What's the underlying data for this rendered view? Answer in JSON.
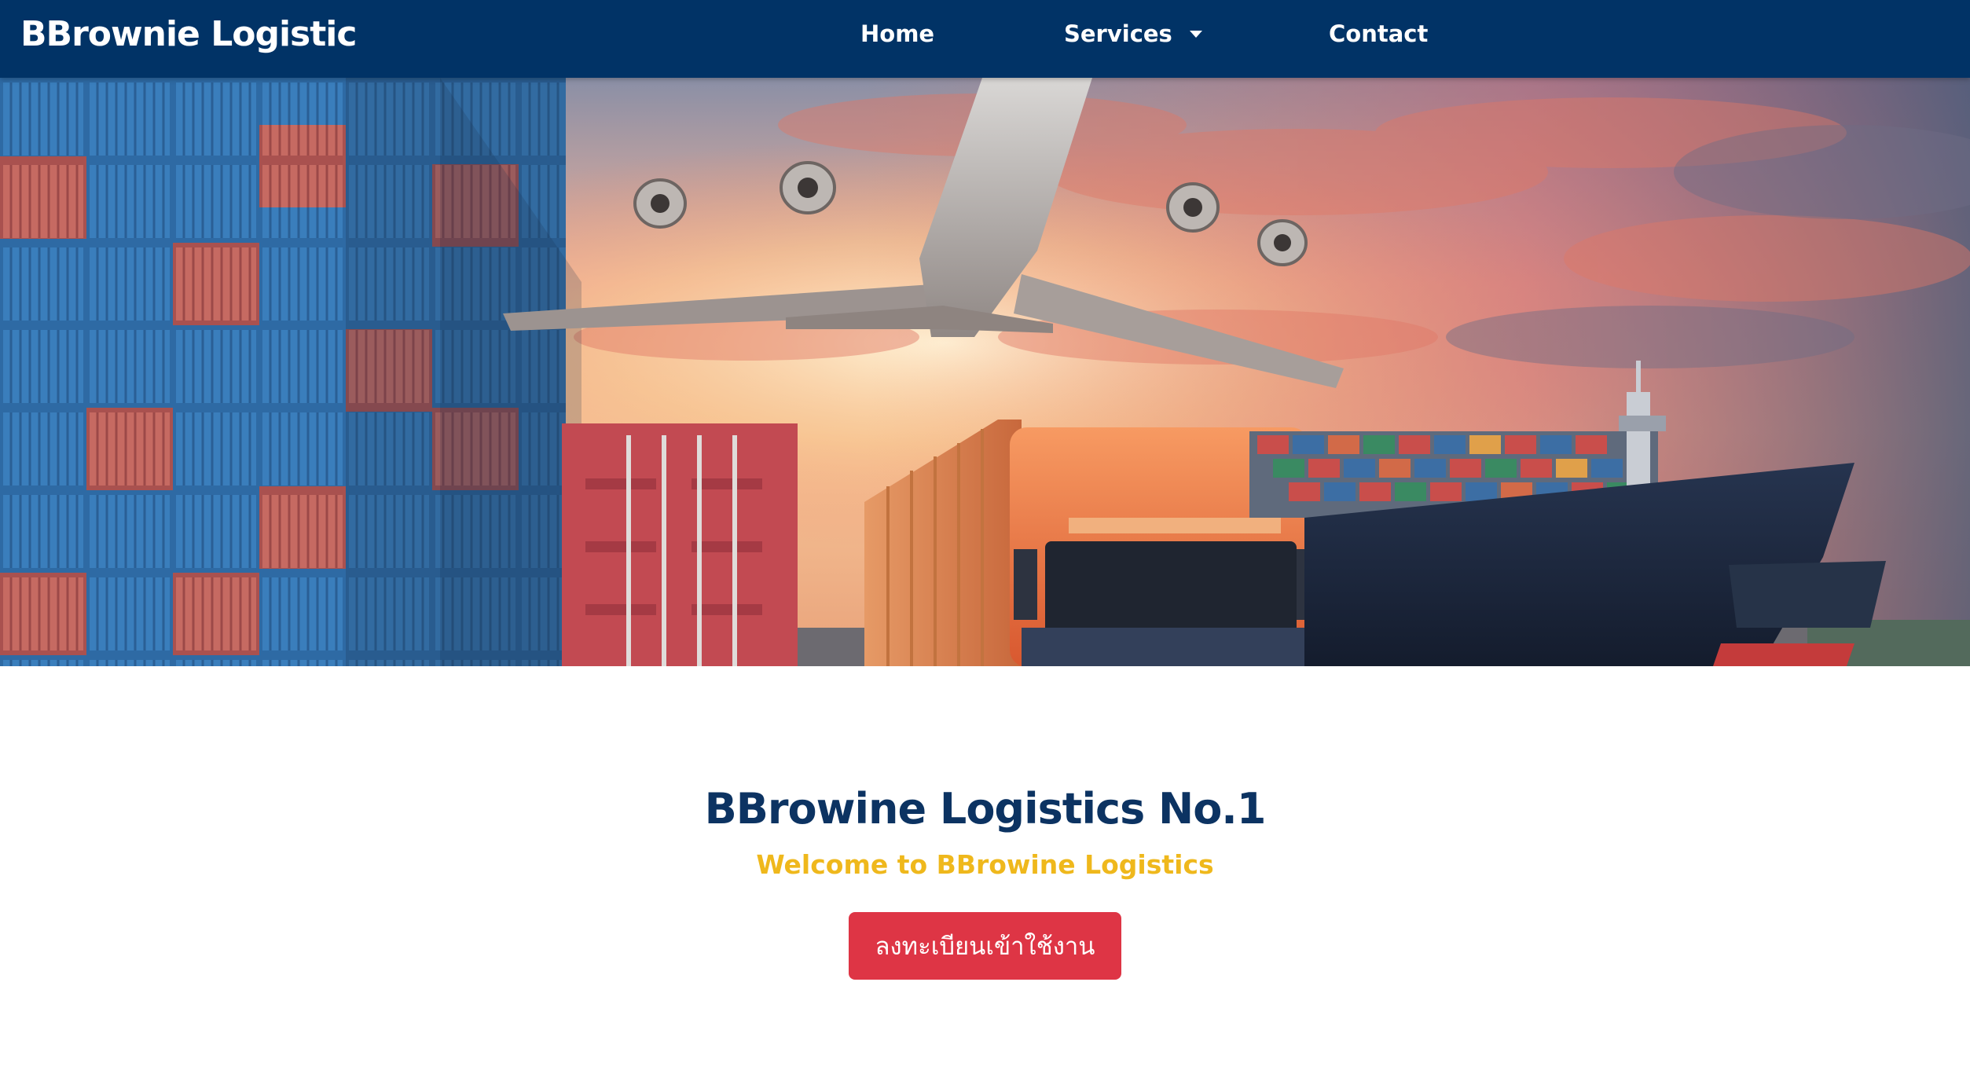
{
  "navbar": {
    "brand": "BBrownie Logistic",
    "links": [
      {
        "label": "Home"
      },
      {
        "label": "Services",
        "has_dropdown": true
      },
      {
        "label": "Contact"
      }
    ],
    "background_color": "#013366"
  },
  "hero": {
    "image_alt": "logistics hero banner"
  },
  "main": {
    "headline": "BBrowine Logistics No.1",
    "subheadline": "Welcome to BBrowine Logistics",
    "cta_label": "ลงทะเบียนเข้าใช้งาน",
    "headline_color": "#0c3362",
    "subheadline_color": "#efb81c",
    "cta_color": "#de3545"
  }
}
